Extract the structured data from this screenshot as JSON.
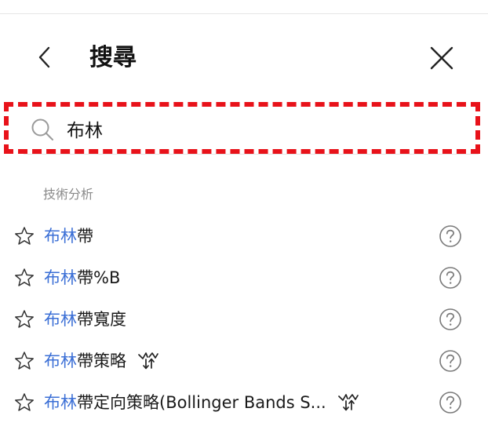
{
  "header": {
    "title": "搜尋",
    "back_icon": "chevron-left-icon",
    "close_icon": "close-icon"
  },
  "search": {
    "value": "布林",
    "icon": "search-icon",
    "highlight_color": "#e8121a"
  },
  "section": {
    "title": "技術分析"
  },
  "results": [
    {
      "highlight": "布林",
      "rest": "帶",
      "has_strategy_icon": false
    },
    {
      "highlight": "布林",
      "rest": "帶%B",
      "has_strategy_icon": false
    },
    {
      "highlight": "布林",
      "rest": "帶寬度",
      "has_strategy_icon": false
    },
    {
      "highlight": "布林",
      "rest": "帶策略",
      "has_strategy_icon": true
    },
    {
      "highlight": "布林",
      "rest": "帶定向策略(Bollinger Bands S...",
      "has_strategy_icon": true
    }
  ],
  "colors": {
    "match_highlight": "#3b6fd6",
    "section_title": "#8a8a8a"
  },
  "icons": {
    "favorite": "star-outline-icon",
    "help": "question-circle-icon",
    "strategy": "strategy-signal-icon"
  }
}
